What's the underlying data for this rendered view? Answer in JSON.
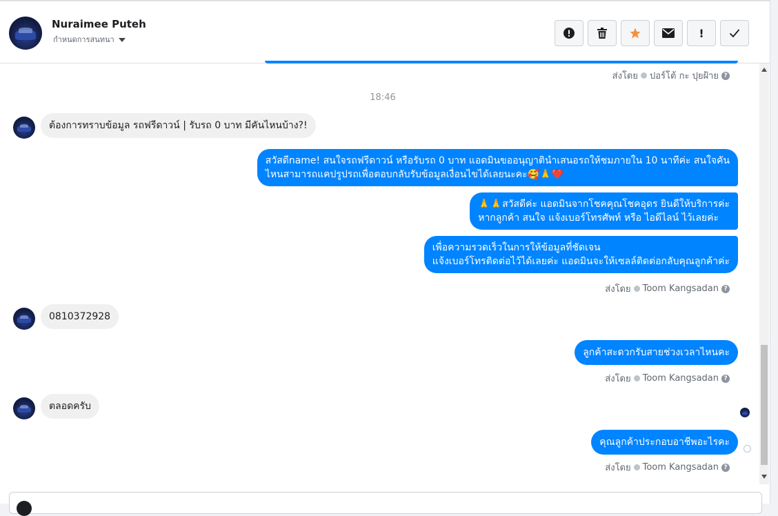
{
  "header": {
    "name": "Nuraimee Puteh",
    "assign_label": "กำหนดการสนทนา"
  },
  "actions": [
    "spam",
    "delete",
    "star",
    "mark-unread",
    "important",
    "done"
  ],
  "colors": {
    "accent": "#0084ff",
    "star": "#f7923b",
    "bubble_in": "#f1f0f0"
  },
  "messages": {
    "sent_prefix": "ส่งโดย",
    "top_sender": "ปอร์โต้ กะ ปุยฝ้าย",
    "time": "18:46",
    "in1": "ต้องการทราบข้อมูล รถฟรีดาวน์ | รับรถ 0 บาท มีคันไหนบ้าง?!",
    "out1_line1": "สวัสดีname! สนใจรถฟรีดาวน์ หรือรับรถ 0 บาท แอดมินขออนุญาตินำเสนอรถให้ชมภายใน 10 นาทีค่ะ สนใจคัน",
    "out1_line2": "ไหนสามารถแคปรูปรถเพื่อตอบกลับรับข้อมูลเงื่อนไขได้เลยนะคะ🥰🙏❤️",
    "out2_line1": "🙏🙏สวัสดีค่ะ แอดมินจากโชคคุณโชคอุดร ยินดีให้บริการค่ะ",
    "out2_line2": "หากลูกค้า สนใจ แจ้งเบอร์โทรศัพท์ หรือ ไอดีไลน์  ไว้เลยค่ะ",
    "out3_line1": "เพื่อความรวดเร็วในการให้ข้อมูลที่ชัดเจน",
    "out3_line2": "แจ้งเบอร์โทรติดต่อไว้ได้เลยค่ะ แอดมินจะให้เซลล์ติดต่อกลับคุณลูกค้าค่ะ",
    "sender": "Toom Kangsadan",
    "in2": "0810372928",
    "out4": "ลูกค้าสะดวกรับสายช่วงเวลาไหนคะ",
    "in3": "ตลอดครับ",
    "out5": "คุณลูกค้าประกอบอาชีพอะไรคะ"
  }
}
